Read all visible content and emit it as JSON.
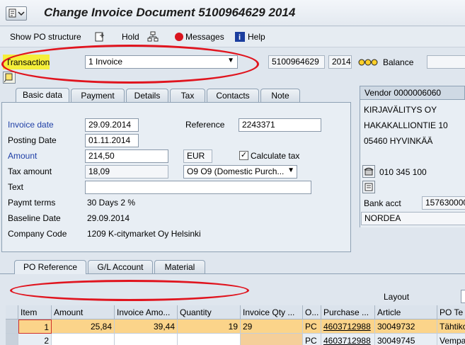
{
  "window": {
    "title": "Change Invoice Document 5100964629 2014"
  },
  "toolbar": {
    "show_po": "Show PO structure",
    "hold": "Hold",
    "messages": "Messages",
    "help": "Help"
  },
  "header": {
    "transaction_label": "Transaction",
    "transaction_value": "1 Invoice",
    "doc_number": "5100964629",
    "year": "2014",
    "balance_label": "Balance"
  },
  "tabs": [
    "Basic data",
    "Payment",
    "Details",
    "Tax",
    "Contacts",
    "Note"
  ],
  "basic": {
    "invoice_date_label": "Invoice date",
    "invoice_date": "29.09.2014",
    "reference_label": "Reference",
    "reference": "2243371",
    "posting_date_label": "Posting Date",
    "posting_date": "01.11.2014",
    "amount_label": "Amount",
    "amount": "214,50",
    "currency": "EUR",
    "calc_tax_label": "Calculate tax",
    "tax_amount_label": "Tax amount",
    "tax_amount": "18,09",
    "tax_code": "O9 O9 (Domestic Purch...",
    "text_label": "Text",
    "text": "",
    "paymt_terms_label": "Paymt terms",
    "paymt_terms": "30 Days 2 %",
    "baseline_label": "Baseline Date",
    "baseline": "29.09.2014",
    "company_label": "Company Code",
    "company": "1209 K-citymarket Oy Helsinki"
  },
  "vendor": {
    "header": "Vendor 0000006060",
    "name": "KIRJAVÄLITYS OY",
    "street": "HAKAKALLIONTIE 10",
    "city": "05460 HYVINKÄÄ",
    "phone": "010 345 100",
    "bank_label": "Bank acct",
    "bank_acct": "157630000",
    "bank_name": "NORDEA"
  },
  "lower_tabs": [
    "PO Reference",
    "G/L Account",
    "Material"
  ],
  "layout_label": "Layout",
  "grid": {
    "columns": [
      "Item",
      "Amount",
      "Invoice Amo...",
      "Quantity",
      "Invoice Qty ...",
      "O...",
      "Purchase ...",
      "Article",
      "PO Te"
    ],
    "rows": [
      [
        "1",
        "25,84",
        "39,44",
        "19",
        "29",
        "PC",
        "4603712988",
        "30049732",
        "Tähtikc"
      ],
      [
        "2",
        "",
        "",
        "",
        "",
        "PC",
        "4603712988",
        "30049745",
        "Vempa"
      ]
    ]
  },
  "colors": {
    "highlight_yellow": "#f5ef3a",
    "annotation_red": "#e0141e",
    "selected_row": "#fbd48a"
  }
}
